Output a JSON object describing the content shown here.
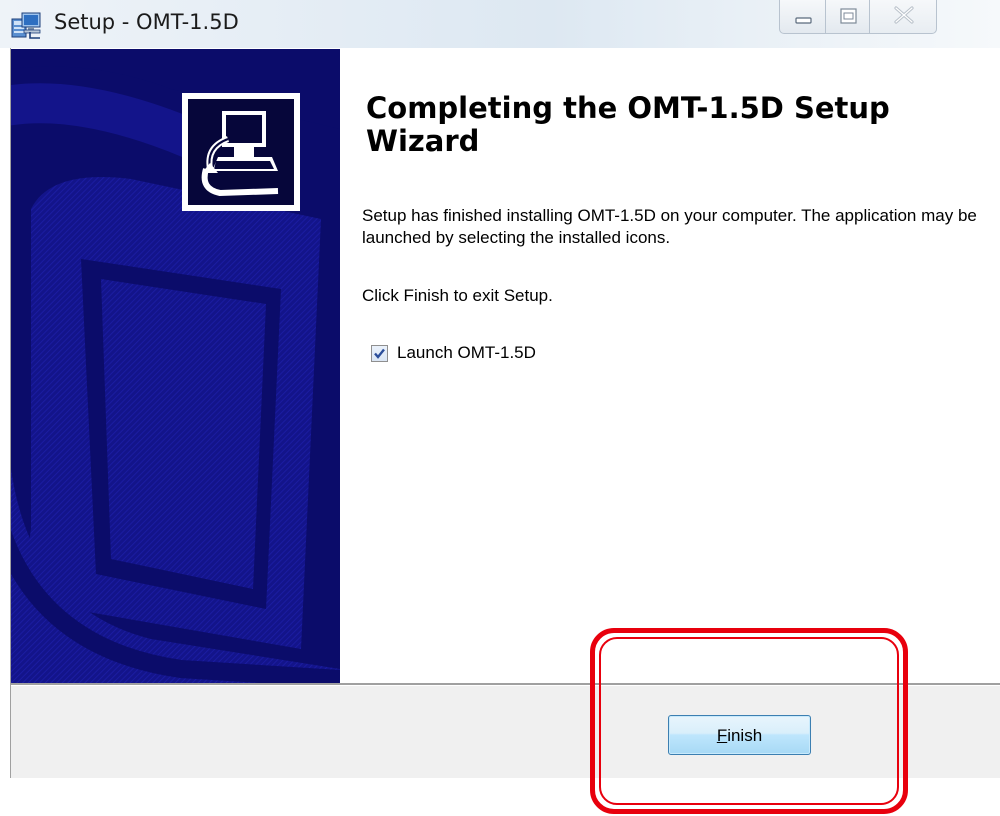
{
  "window": {
    "title": "Setup - OMT-1.5D",
    "icon": "setup-installer-icon",
    "caption_buttons": [
      "minimize",
      "maximize",
      "close"
    ]
  },
  "banner": {
    "logo_icon": "computer-install-icon"
  },
  "content": {
    "heading": "Completing the OMT-1.5D Setup Wizard",
    "description": "Setup has finished installing OMT-1.5D on your computer. The application may be launched by selecting the installed icons.",
    "instruction": "Click Finish to exit Setup.",
    "launch_checkbox": {
      "label": "Launch OMT-1.5D",
      "checked": true
    }
  },
  "footer": {
    "finish_button": {
      "mnemonic": "F",
      "rest": "inish"
    }
  },
  "colors": {
    "banner": "#0b0c6a",
    "highlight": "#e8000d",
    "button_border": "#3c7fb1"
  }
}
